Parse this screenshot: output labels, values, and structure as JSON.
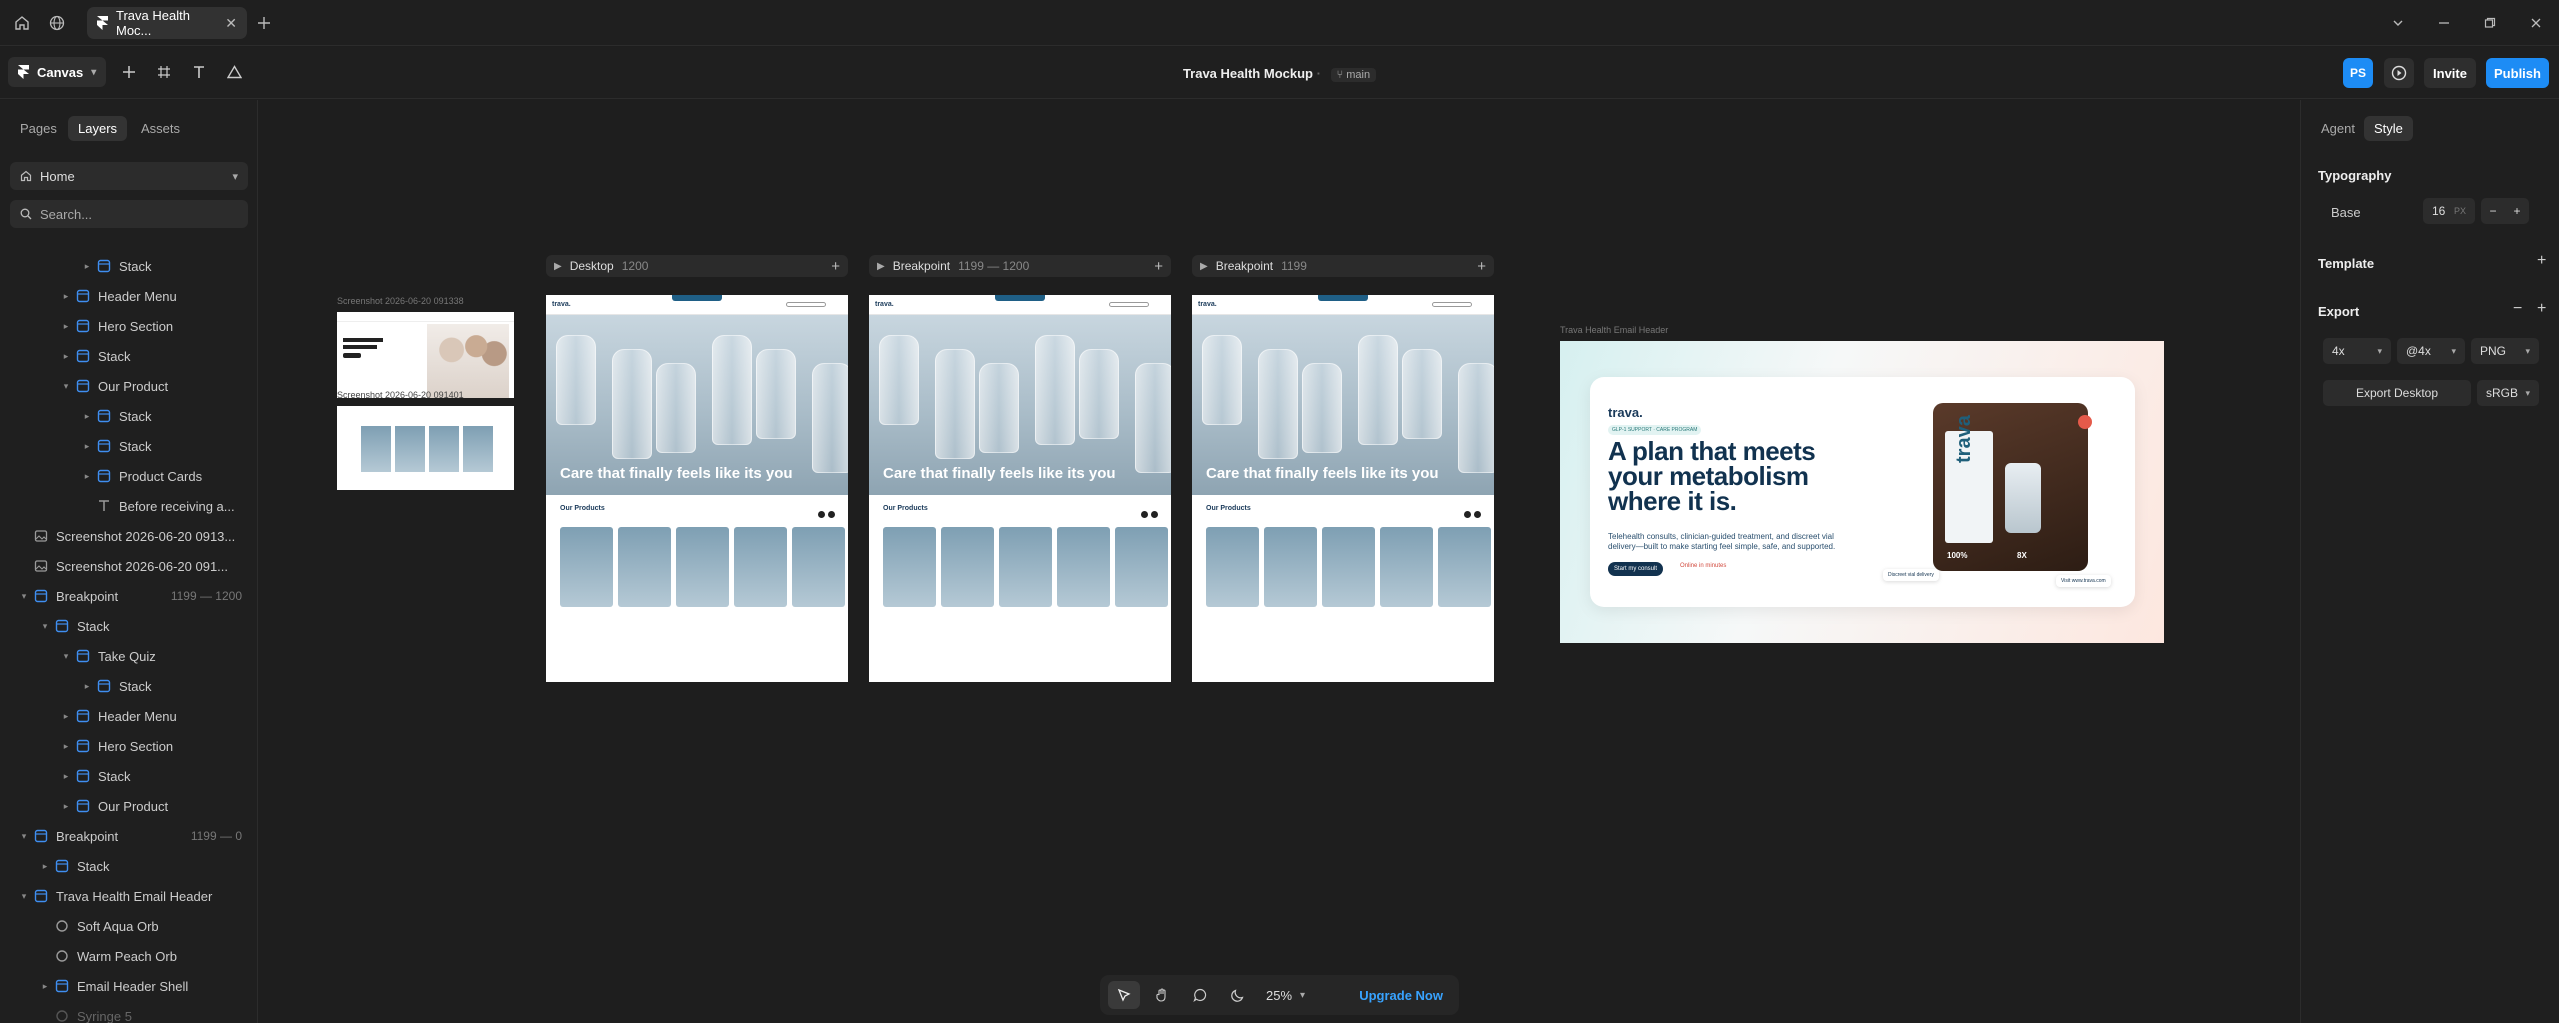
{
  "titlebar": {
    "tab_title": "Trava Health Moc..."
  },
  "toolbar": {
    "canvas_label": "Canvas",
    "doc_title": "Trava Health Mockup",
    "branch": "main",
    "avatar_initials": "PS",
    "invite": "Invite",
    "publish": "Publish"
  },
  "left": {
    "tabs": [
      "Pages",
      "Layers",
      "Assets"
    ],
    "page_select": "Home",
    "search_placeholder": "Search...",
    "layers": [
      {
        "label": "Stack",
        "indent": 3,
        "icon": "frame",
        "caret": "right"
      },
      {
        "label": "Header Menu",
        "indent": 2,
        "icon": "frame",
        "caret": "right"
      },
      {
        "label": "Hero Section",
        "indent": 2,
        "icon": "frame",
        "caret": "right"
      },
      {
        "label": "Stack",
        "indent": 2,
        "icon": "frame",
        "caret": "right"
      },
      {
        "label": "Our Product",
        "indent": 2,
        "icon": "frame",
        "caret": "down"
      },
      {
        "label": "Stack",
        "indent": 3,
        "icon": "frame",
        "caret": "right"
      },
      {
        "label": "Stack",
        "indent": 3,
        "icon": "frame",
        "caret": "right"
      },
      {
        "label": "Product Cards",
        "indent": 3,
        "icon": "frame",
        "caret": "right"
      },
      {
        "label": "Before receiving a...",
        "indent": 3,
        "icon": "text",
        "caret": ""
      },
      {
        "label": "Screenshot 2026-06-20 0913...",
        "indent": 0,
        "icon": "image",
        "caret": ""
      },
      {
        "label": "Screenshot 2026-06-20 091...",
        "indent": 0,
        "icon": "image",
        "caret": ""
      },
      {
        "label": "Breakpoint",
        "indent": 0,
        "icon": "frame",
        "caret": "down",
        "range": "1199 — 1200"
      },
      {
        "label": "Stack",
        "indent": 1,
        "icon": "frame",
        "caret": "down"
      },
      {
        "label": "Take Quiz",
        "indent": 2,
        "icon": "frame",
        "caret": "down"
      },
      {
        "label": "Stack",
        "indent": 3,
        "icon": "frame",
        "caret": "right"
      },
      {
        "label": "Header Menu",
        "indent": 2,
        "icon": "frame",
        "caret": "right"
      },
      {
        "label": "Hero Section",
        "indent": 2,
        "icon": "frame",
        "caret": "right"
      },
      {
        "label": "Stack",
        "indent": 2,
        "icon": "frame",
        "caret": "right"
      },
      {
        "label": "Our Product",
        "indent": 2,
        "icon": "frame",
        "caret": "right"
      },
      {
        "label": "Breakpoint",
        "indent": 0,
        "icon": "frame",
        "caret": "down",
        "range": "1199 — 0"
      },
      {
        "label": "Stack",
        "indent": 1,
        "icon": "frame",
        "caret": "right"
      },
      {
        "label": "Trava Health Email Header",
        "indent": 0,
        "icon": "frame",
        "caret": "down"
      },
      {
        "label": "Soft Aqua Orb",
        "indent": 1,
        "icon": "circle",
        "caret": ""
      },
      {
        "label": "Warm Peach Orb",
        "indent": 1,
        "icon": "circle",
        "caret": ""
      },
      {
        "label": "Email Header Shell",
        "indent": 1,
        "icon": "frame",
        "caret": "right"
      },
      {
        "label": "Syringe 5",
        "indent": 1,
        "icon": "circle",
        "caret": "",
        "dim": true
      }
    ]
  },
  "canvas": {
    "screenshot_label": "Screenshot 2026-06-20 091338",
    "screenshot_label2": "Screenshot 2026-06-20 091401",
    "frames": [
      {
        "name": "Desktop",
        "sub": "1200"
      },
      {
        "name": "Breakpoint",
        "sub": "1199 — 1200"
      },
      {
        "name": "Breakpoint",
        "sub": "1199"
      }
    ],
    "hero_title": "Care that finally feels like its you",
    "products_label": "Our Products",
    "email_label": "Trava Health Email Header",
    "email": {
      "brand": "trava.",
      "tag": "GLP-1 SUPPORT · CARE PROGRAM",
      "headline": "A plan that meets your metabolism where it is.",
      "body": "Telehealth consults, clinician-guided treatment, and discreet vial delivery—built to make starting feel simple, safe, and supported.",
      "cta": "Start my consult",
      "online": "Online in minutes",
      "badge1": "Discreet vial delivery",
      "badge2": "Visit www.trava.com",
      "stat1": "100%",
      "stat2": "8X"
    }
  },
  "bottom": {
    "zoom": "25%",
    "upgrade": "Upgrade Now"
  },
  "right": {
    "tabs": [
      "Agent",
      "Style"
    ],
    "typography": "Typography",
    "base_label": "Base",
    "base_value": "16",
    "base_unit": "PX",
    "template": "Template",
    "export": "Export",
    "scale": "4x",
    "suffix": "@4x",
    "format": "PNG",
    "export_button": "Export Desktop",
    "colorspace": "sRGB"
  }
}
